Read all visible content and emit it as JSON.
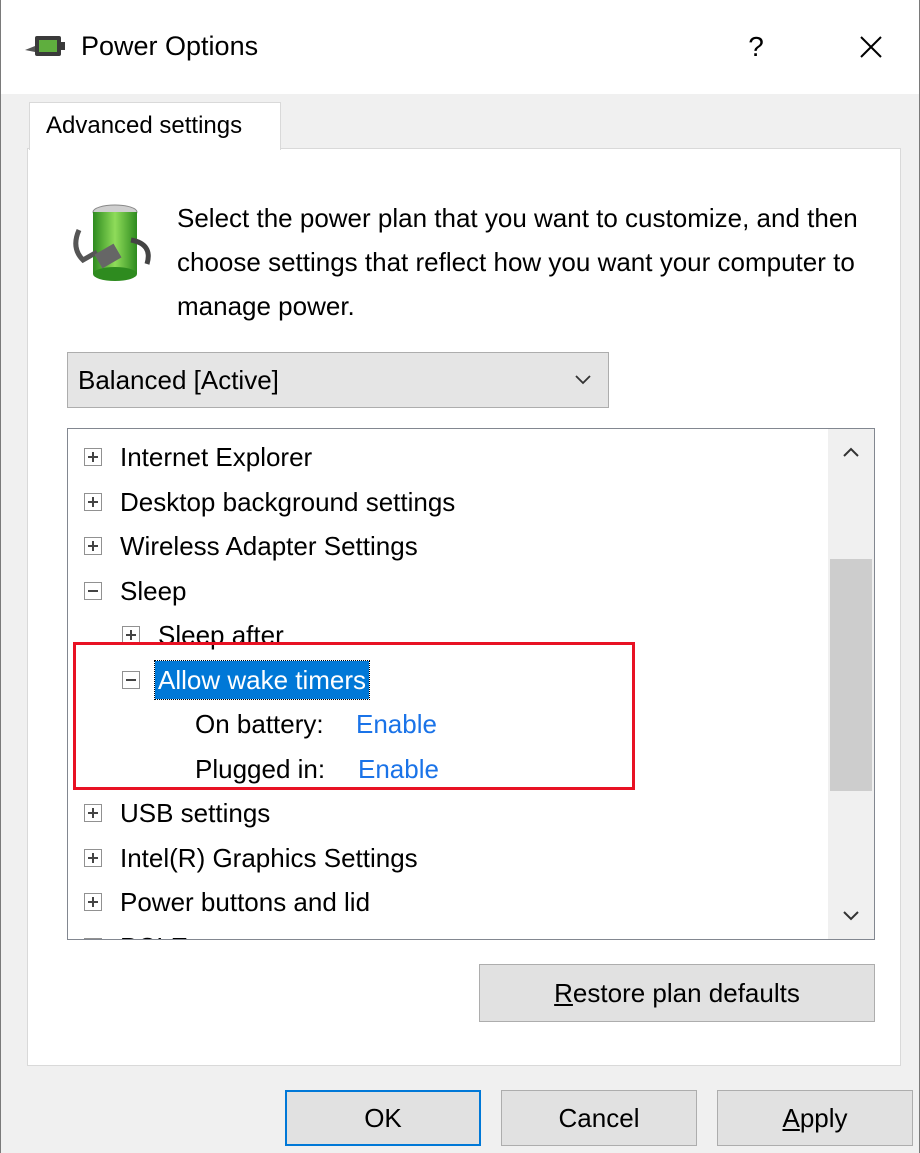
{
  "window": {
    "title": "Power Options",
    "help_label": "?",
    "icons": {
      "app": "power-options-icon",
      "close": "close-icon"
    }
  },
  "tabs": [
    {
      "label": "Advanced settings",
      "active": true
    }
  ],
  "description": "Select the power plan that you want to customize, and then choose settings that reflect how you want your computer to manage power.",
  "plan_select": {
    "value": "Balanced [Active]",
    "icon": "chevron-down-icon"
  },
  "tree": {
    "items": [
      {
        "label": "Internet Explorer",
        "expander": "plus"
      },
      {
        "label": "Desktop background settings",
        "expander": "plus"
      },
      {
        "label": "Wireless Adapter Settings",
        "expander": "plus"
      },
      {
        "label": "Sleep",
        "expander": "minus"
      },
      {
        "label": "Sleep after",
        "expander": "plus"
      },
      {
        "label": "Allow wake timers",
        "expander": "minus",
        "selected": true
      },
      {
        "label": "On battery:",
        "value": "Enable"
      },
      {
        "label": "Plugged in:",
        "value": "Enable"
      },
      {
        "label": "USB settings",
        "expander": "plus"
      },
      {
        "label": "Intel(R) Graphics Settings",
        "expander": "plus"
      },
      {
        "label": "Power buttons and lid",
        "expander": "plus"
      },
      {
        "label": "PCI Express",
        "expander": "plus"
      }
    ],
    "scrollbar_icons": {
      "up": "chevron-up-icon",
      "down": "chevron-down-icon"
    }
  },
  "buttons": {
    "restore": {
      "mnemonic": "R",
      "rest": "estore plan defaults"
    },
    "ok": "OK",
    "cancel": "Cancel",
    "apply": {
      "mnemonic": "A",
      "rest": "pply"
    }
  },
  "colors": {
    "highlight_border": "#e81123",
    "selection": "#0078d7",
    "link": "#1a73e8"
  }
}
